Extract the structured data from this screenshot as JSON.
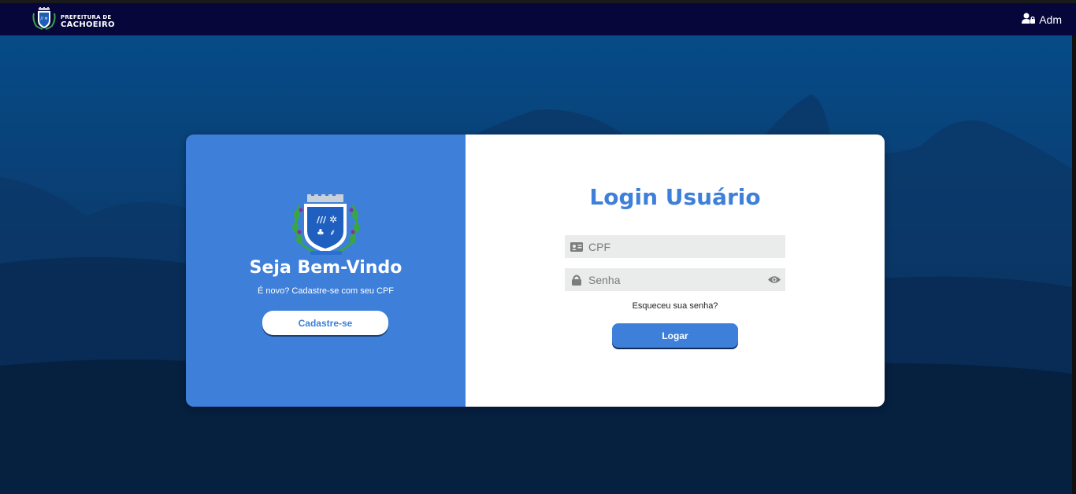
{
  "header": {
    "brand_line1": "PREFEITURA DE",
    "brand_line2": "CACHOEIRO",
    "user_label": "Adm"
  },
  "welcome_panel": {
    "title": "Seja Bem-Vindo",
    "subtitle": "É novo? Cadastre-se com seu CPF",
    "register_button": "Cadastre-se"
  },
  "login_panel": {
    "title": "Login Usuário",
    "cpf_placeholder": "CPF",
    "password_placeholder": "Senha",
    "forgot_link": "Esqueceu sua senha?",
    "login_button": "Logar"
  },
  "icons": {
    "cpf": "id-card-icon",
    "password": "lock-icon",
    "toggle_password": "eye-icon",
    "user": "user-lock-icon"
  },
  "colors": {
    "navbar": "#06063a",
    "accent": "#3d7fd9",
    "field_bg": "#e9eceb"
  }
}
